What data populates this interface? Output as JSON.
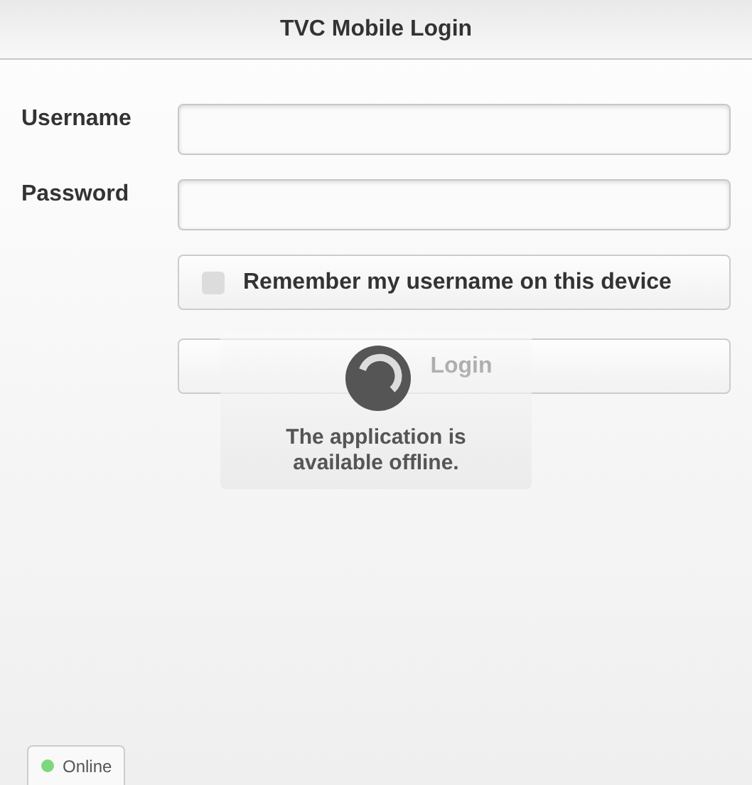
{
  "header": {
    "title": "TVC Mobile Login"
  },
  "fields": [
    {
      "label": "Username"
    },
    {
      "label": "Password"
    }
  ],
  "remember": {
    "label": "Remember my username on this device",
    "checked": false
  },
  "login_button": {
    "label": "Login"
  },
  "loading_popup": {
    "message": "The application is available offline."
  },
  "status": {
    "label": "Online",
    "color": "#7dd87d"
  }
}
